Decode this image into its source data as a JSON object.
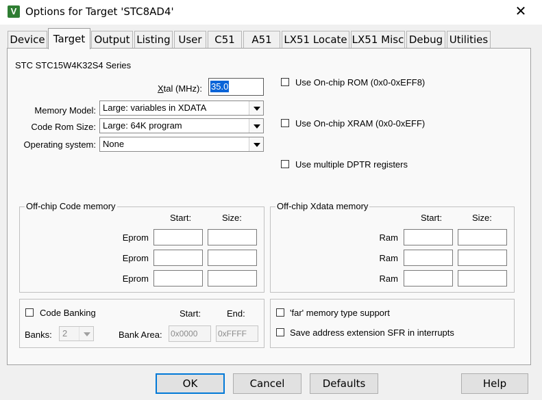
{
  "window": {
    "title": "Options for Target 'STC8AD4'",
    "app_icon_letter": "V",
    "close_glyph": "✕"
  },
  "tabs": [
    {
      "label": "Device",
      "active": false
    },
    {
      "label": "Target",
      "active": true
    },
    {
      "label": "Output",
      "active": false
    },
    {
      "label": "Listing",
      "active": false
    },
    {
      "label": "User",
      "active": false
    },
    {
      "label": "C51",
      "active": false
    },
    {
      "label": "A51",
      "active": false
    },
    {
      "label": "LX51 Locate",
      "active": false
    },
    {
      "label": "LX51 Misc",
      "active": false
    },
    {
      "label": "Debug",
      "active": false
    },
    {
      "label": "Utilities",
      "active": false
    }
  ],
  "target": {
    "device_series": "STC STC15W4K32S4 Series",
    "xtal": {
      "label_prefix": "X",
      "label_rest": "tal (MHz):",
      "value": "35.0"
    },
    "memory_model": {
      "label": "Memory Model:",
      "value": "Large: variables in XDATA"
    },
    "code_rom_size": {
      "label": "Code Rom Size:",
      "value": "Large: 64K program"
    },
    "operating_system": {
      "label": "Operating system:",
      "value": "None"
    },
    "options": {
      "on_chip_rom": {
        "label": "Use On-chip ROM (0x0-0xEFF8)",
        "checked": false
      },
      "on_chip_xram": {
        "label": "Use On-chip XRAM (0x0-0xEFF)",
        "checked": false
      },
      "multiple_dptr": {
        "label": "Use multiple DPTR registers",
        "checked": false
      }
    }
  },
  "code_memory": {
    "title": "Off-chip Code memory",
    "start_header": "Start:",
    "size_header": "Size:",
    "rows": [
      {
        "label": "Eprom",
        "start": "",
        "size": ""
      },
      {
        "label": "Eprom",
        "start": "",
        "size": ""
      },
      {
        "label": "Eprom",
        "start": "",
        "size": ""
      }
    ]
  },
  "xdata_memory": {
    "title": "Off-chip Xdata memory",
    "start_header": "Start:",
    "size_header": "Size:",
    "rows": [
      {
        "label": "Ram",
        "start": "",
        "size": ""
      },
      {
        "label": "Ram",
        "start": "",
        "size": ""
      },
      {
        "label": "Ram",
        "start": "",
        "size": ""
      }
    ]
  },
  "banking": {
    "code_banking_label": "Code Banking",
    "code_banking_checked": false,
    "start_header": "Start:",
    "end_header": "End:",
    "banks_label": "Banks:",
    "banks_value": "2",
    "bank_area_label": "Bank Area:",
    "bank_area_start": "0x0000",
    "bank_area_end": "0xFFFF"
  },
  "far_options": {
    "far_memory": {
      "label": "'far' memory type support",
      "checked": false
    },
    "save_sfr": {
      "label": "Save address extension SFR in interrupts",
      "checked": false
    }
  },
  "buttons": {
    "ok": "OK",
    "cancel": "Cancel",
    "defaults": "Defaults",
    "help": "Help"
  },
  "colors": {
    "selection": "#0a64d8",
    "app_icon": "#2e7d32",
    "dialog_bg": "#f0f0f0",
    "panel_bg": "#f9f9f9"
  }
}
